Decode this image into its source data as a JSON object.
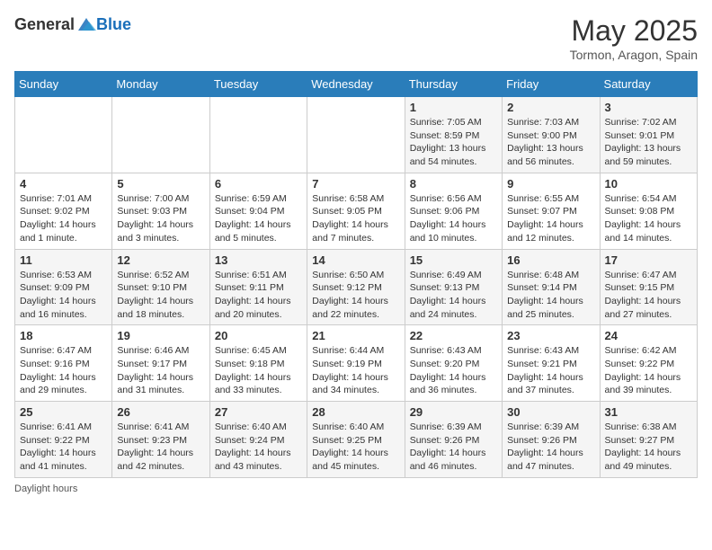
{
  "header": {
    "logo_general": "General",
    "logo_blue": "Blue",
    "month_title": "May 2025",
    "subtitle": "Tormon, Aragon, Spain"
  },
  "days_of_week": [
    "Sunday",
    "Monday",
    "Tuesday",
    "Wednesday",
    "Thursday",
    "Friday",
    "Saturday"
  ],
  "weeks": [
    [
      {
        "day": "",
        "info": ""
      },
      {
        "day": "",
        "info": ""
      },
      {
        "day": "",
        "info": ""
      },
      {
        "day": "",
        "info": ""
      },
      {
        "day": "1",
        "info": "Sunrise: 7:05 AM\nSunset: 8:59 PM\nDaylight: 13 hours\nand 54 minutes."
      },
      {
        "day": "2",
        "info": "Sunrise: 7:03 AM\nSunset: 9:00 PM\nDaylight: 13 hours\nand 56 minutes."
      },
      {
        "day": "3",
        "info": "Sunrise: 7:02 AM\nSunset: 9:01 PM\nDaylight: 13 hours\nand 59 minutes."
      }
    ],
    [
      {
        "day": "4",
        "info": "Sunrise: 7:01 AM\nSunset: 9:02 PM\nDaylight: 14 hours\nand 1 minute."
      },
      {
        "day": "5",
        "info": "Sunrise: 7:00 AM\nSunset: 9:03 PM\nDaylight: 14 hours\nand 3 minutes."
      },
      {
        "day": "6",
        "info": "Sunrise: 6:59 AM\nSunset: 9:04 PM\nDaylight: 14 hours\nand 5 minutes."
      },
      {
        "day": "7",
        "info": "Sunrise: 6:58 AM\nSunset: 9:05 PM\nDaylight: 14 hours\nand 7 minutes."
      },
      {
        "day": "8",
        "info": "Sunrise: 6:56 AM\nSunset: 9:06 PM\nDaylight: 14 hours\nand 10 minutes."
      },
      {
        "day": "9",
        "info": "Sunrise: 6:55 AM\nSunset: 9:07 PM\nDaylight: 14 hours\nand 12 minutes."
      },
      {
        "day": "10",
        "info": "Sunrise: 6:54 AM\nSunset: 9:08 PM\nDaylight: 14 hours\nand 14 minutes."
      }
    ],
    [
      {
        "day": "11",
        "info": "Sunrise: 6:53 AM\nSunset: 9:09 PM\nDaylight: 14 hours\nand 16 minutes."
      },
      {
        "day": "12",
        "info": "Sunrise: 6:52 AM\nSunset: 9:10 PM\nDaylight: 14 hours\nand 18 minutes."
      },
      {
        "day": "13",
        "info": "Sunrise: 6:51 AM\nSunset: 9:11 PM\nDaylight: 14 hours\nand 20 minutes."
      },
      {
        "day": "14",
        "info": "Sunrise: 6:50 AM\nSunset: 9:12 PM\nDaylight: 14 hours\nand 22 minutes."
      },
      {
        "day": "15",
        "info": "Sunrise: 6:49 AM\nSunset: 9:13 PM\nDaylight: 14 hours\nand 24 minutes."
      },
      {
        "day": "16",
        "info": "Sunrise: 6:48 AM\nSunset: 9:14 PM\nDaylight: 14 hours\nand 25 minutes."
      },
      {
        "day": "17",
        "info": "Sunrise: 6:47 AM\nSunset: 9:15 PM\nDaylight: 14 hours\nand 27 minutes."
      }
    ],
    [
      {
        "day": "18",
        "info": "Sunrise: 6:47 AM\nSunset: 9:16 PM\nDaylight: 14 hours\nand 29 minutes."
      },
      {
        "day": "19",
        "info": "Sunrise: 6:46 AM\nSunset: 9:17 PM\nDaylight: 14 hours\nand 31 minutes."
      },
      {
        "day": "20",
        "info": "Sunrise: 6:45 AM\nSunset: 9:18 PM\nDaylight: 14 hours\nand 33 minutes."
      },
      {
        "day": "21",
        "info": "Sunrise: 6:44 AM\nSunset: 9:19 PM\nDaylight: 14 hours\nand 34 minutes."
      },
      {
        "day": "22",
        "info": "Sunrise: 6:43 AM\nSunset: 9:20 PM\nDaylight: 14 hours\nand 36 minutes."
      },
      {
        "day": "23",
        "info": "Sunrise: 6:43 AM\nSunset: 9:21 PM\nDaylight: 14 hours\nand 37 minutes."
      },
      {
        "day": "24",
        "info": "Sunrise: 6:42 AM\nSunset: 9:22 PM\nDaylight: 14 hours\nand 39 minutes."
      }
    ],
    [
      {
        "day": "25",
        "info": "Sunrise: 6:41 AM\nSunset: 9:22 PM\nDaylight: 14 hours\nand 41 minutes."
      },
      {
        "day": "26",
        "info": "Sunrise: 6:41 AM\nSunset: 9:23 PM\nDaylight: 14 hours\nand 42 minutes."
      },
      {
        "day": "27",
        "info": "Sunrise: 6:40 AM\nSunset: 9:24 PM\nDaylight: 14 hours\nand 43 minutes."
      },
      {
        "day": "28",
        "info": "Sunrise: 6:40 AM\nSunset: 9:25 PM\nDaylight: 14 hours\nand 45 minutes."
      },
      {
        "day": "29",
        "info": "Sunrise: 6:39 AM\nSunset: 9:26 PM\nDaylight: 14 hours\nand 46 minutes."
      },
      {
        "day": "30",
        "info": "Sunrise: 6:39 AM\nSunset: 9:26 PM\nDaylight: 14 hours\nand 47 minutes."
      },
      {
        "day": "31",
        "info": "Sunrise: 6:38 AM\nSunset: 9:27 PM\nDaylight: 14 hours\nand 49 minutes."
      }
    ]
  ],
  "footer": {
    "daylight_hours_label": "Daylight hours"
  }
}
